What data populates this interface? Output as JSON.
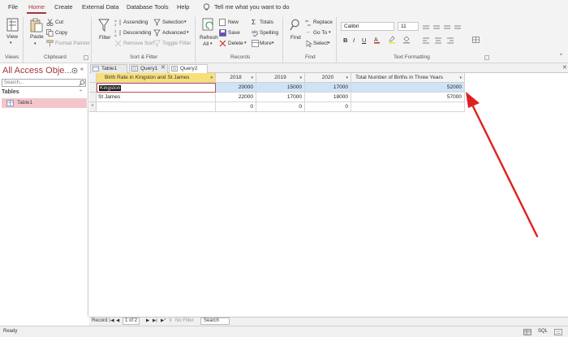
{
  "menu": {
    "items": [
      "File",
      "Home",
      "Create",
      "External Data",
      "Database Tools",
      "Help"
    ],
    "tell_me": "Tell me what you want to do",
    "accent": "#a4373a"
  },
  "ribbon": {
    "views": {
      "view": "View",
      "label": "Views"
    },
    "clipboard": {
      "paste": "Paste",
      "cut": "Cut",
      "copy": "Copy",
      "format_painter": "Format Painter",
      "label": "Clipboard"
    },
    "sort_filter": {
      "filter": "Filter",
      "ascending": "Ascending",
      "descending": "Descending",
      "remove_sort": "Remove Sort",
      "selection": "Selection",
      "advanced": "Advanced",
      "toggle_filter": "Toggle Filter",
      "label": "Sort & Filter"
    },
    "records": {
      "refresh": "Refresh",
      "all": "All",
      "new": "New",
      "save": "Save",
      "delete": "Delete",
      "totals": "Totals",
      "spelling": "Spelling",
      "more": "More",
      "label": "Records"
    },
    "find": {
      "find": "Find",
      "replace": "Replace",
      "goto": "Go To",
      "select": "Select",
      "label": "Find"
    },
    "text_formatting": {
      "font": "Calibri",
      "size": "11",
      "bold": "B",
      "italic": "I",
      "underline": "U",
      "label": "Text Formatting"
    }
  },
  "nav": {
    "title": "All Access Obje...",
    "search_placeholder": "Search...",
    "section": "Tables",
    "items": [
      "Table1"
    ]
  },
  "tabs": [
    {
      "label": "Table1"
    },
    {
      "label": "Query1"
    },
    {
      "label": "Query2"
    }
  ],
  "grid": {
    "headers": [
      "Birth Rate in Kingston and St James",
      "2018",
      "2019",
      "2020",
      "Total Number of Births in Three Years"
    ],
    "rows": [
      {
        "name": "Kingston",
        "y2018": "20000",
        "y2019": "15000",
        "y2020": "17000",
        "total": "52000"
      },
      {
        "name": "St James",
        "y2018": "22000",
        "y2019": "17000",
        "y2020": "18000",
        "total": "57000"
      }
    ],
    "new_row": {
      "marker": "*",
      "y2018": "0",
      "y2019": "0",
      "y2020": "0"
    }
  },
  "record_nav": {
    "label": "Record:",
    "position": "1 of 2",
    "filter": "No Filter",
    "search": "Search"
  },
  "status": {
    "text": "Ready",
    "sql": "SQL"
  },
  "annotation": {
    "color": "#e02020"
  }
}
